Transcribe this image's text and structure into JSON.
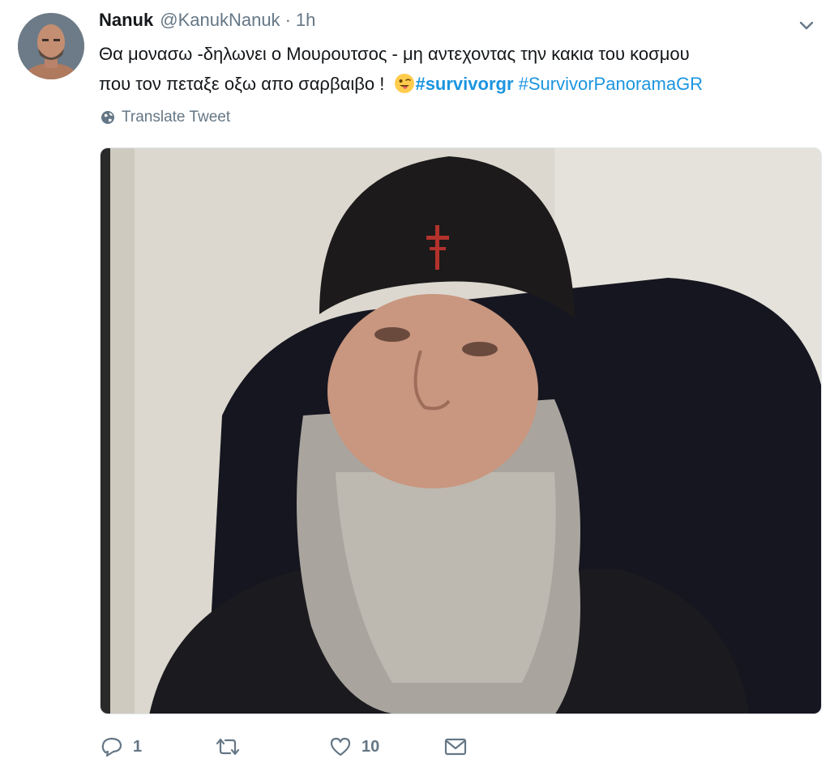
{
  "tweet": {
    "display_name": "Nanuk",
    "handle": "@KanukNanuk",
    "separator": "·",
    "time": "1h",
    "text_line1": "Θα μονασω -δηλωνει ο Μουρουτσος - μη αντεχοντας την κακια του κοσμου",
    "text_line2_prefix": "που τον πεταξε οξω απο σαρβαιβο !",
    "hashtag1": "#survivorgr",
    "hashtag2": "#SurvivorPanoramaGR",
    "emoji": "winking-tongue-face-icon",
    "translate_label": "Translate Tweet"
  },
  "actions": {
    "reply_count": "1",
    "retweet_count": "",
    "like_count": "10"
  },
  "colors": {
    "link": "#1b95e0",
    "muted": "#657786",
    "text": "#14171a"
  }
}
